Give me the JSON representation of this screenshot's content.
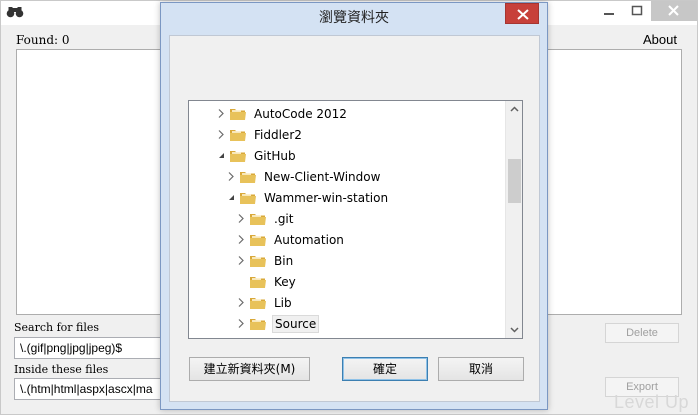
{
  "main": {
    "found_label": "Found: 0",
    "about_label": "About",
    "search_label": "Search for files",
    "search_value": "\\.(gif|png|jpg|jpeg)$",
    "inside_label": "Inside these files",
    "inside_value": "\\.(htm|html|aspx|ascx|ma",
    "delete_label": "Delete",
    "export_label": "Export"
  },
  "watermark": "Level Up",
  "dialog": {
    "title": "瀏覽資料夾",
    "new_folder_label": "建立新資料夾(M)",
    "ok_label": "確定",
    "cancel_label": "取消",
    "tree": [
      {
        "label": "AutoCode 2012",
        "level": 0,
        "state": "collapsed"
      },
      {
        "label": "Fiddler2",
        "level": 0,
        "state": "collapsed"
      },
      {
        "label": "GitHub",
        "level": 0,
        "state": "expanded"
      },
      {
        "label": "New-Client-Window",
        "level": 1,
        "state": "collapsed"
      },
      {
        "label": "Wammer-win-station",
        "level": 1,
        "state": "expanded"
      },
      {
        "label": ".git",
        "level": 2,
        "state": "collapsed"
      },
      {
        "label": "Automation",
        "level": 2,
        "state": "collapsed"
      },
      {
        "label": "Bin",
        "level": 2,
        "state": "collapsed"
      },
      {
        "label": "Key",
        "level": 2,
        "state": "none"
      },
      {
        "label": "Lib",
        "level": 2,
        "state": "collapsed"
      },
      {
        "label": "Source",
        "level": 2,
        "state": "collapsed",
        "selected": true
      }
    ]
  },
  "colors": {
    "folder": "#e8c25a",
    "dialog_close": "#c7403a",
    "dialog_frame": "#d4e2f3"
  }
}
